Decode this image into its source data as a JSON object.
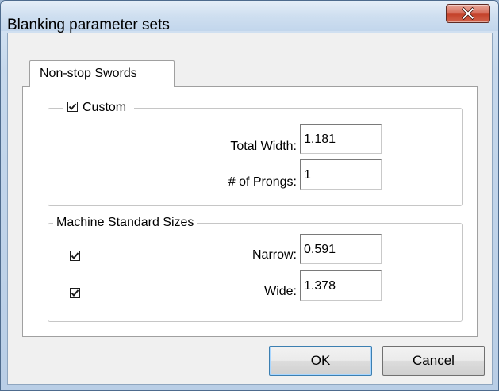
{
  "window": {
    "title": "Blanking parameter sets"
  },
  "tabs": [
    {
      "label": "Non-stop Swords",
      "selected": true
    }
  ],
  "custom_group": {
    "label": "Custom",
    "checked": true,
    "fields": [
      {
        "label": "Total Width:",
        "value": "1.181"
      },
      {
        "label": "# of Prongs:",
        "value": "1"
      }
    ]
  },
  "standard_group": {
    "label": "Machine Standard Sizes",
    "rows": [
      {
        "checked": true,
        "label": "Narrow:",
        "value": "0.591"
      },
      {
        "checked": true,
        "label": "Wide:",
        "value": "1.378"
      }
    ]
  },
  "buttons": {
    "ok_label": "OK",
    "cancel_label": "Cancel"
  },
  "icons": {
    "close": "close-icon",
    "checkmark": "checkmark-icon"
  }
}
